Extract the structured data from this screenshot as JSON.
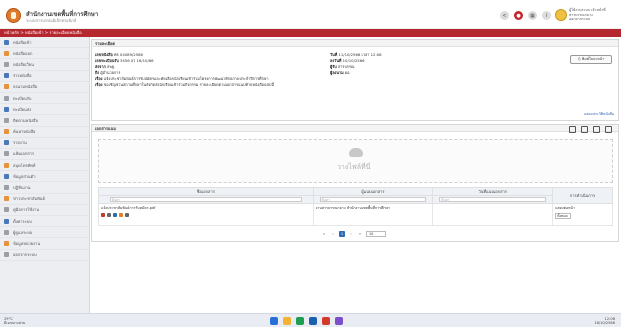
{
  "header": {
    "title": "สำนักงานเขตพื้นที่การศึกษา",
    "subtitle": "ระบบสารบรรณอิเล็กทรอนิกส์",
    "user_line1": "ผู้ใช้งานระบบ เจ้าหน้าที่",
    "user_line2": "สารบรรณกลาง",
    "user_line3": "ออกจากระบบ"
  },
  "breadcrumb": "หน้าหลัก > หนังสือเข้า > รายละเอียดหนังสือ",
  "sidebar": {
    "items": [
      {
        "label": "หนังสือเข้า",
        "icon": "inbox-icon"
      },
      {
        "label": "หนังสือออก",
        "icon": "outbox-icon"
      },
      {
        "label": "หนังสือเวียน",
        "icon": "edit-icon"
      },
      {
        "label": "ร่างหนังสือ",
        "icon": "pencil-icon"
      },
      {
        "label": "ลงนามหนังสือ",
        "icon": "document-icon"
      },
      {
        "label": "ทะเบียนรับ",
        "icon": "user-icon"
      },
      {
        "label": "ทะเบียนส่ง",
        "icon": "send-icon"
      },
      {
        "label": "ติดตามหนังสือ",
        "icon": "flag-icon"
      },
      {
        "label": "ค้นหาหนังสือ",
        "icon": "search-icon"
      },
      {
        "label": "รายงาน",
        "icon": "chart-icon"
      },
      {
        "label": "แฟ้มเอกสาร",
        "icon": "folder-icon"
      },
      {
        "label": "สมุดโทรศัพท์",
        "icon": "phone-icon"
      },
      {
        "label": "ข้อมูลส่วนตัว",
        "icon": "person-icon"
      },
      {
        "label": "ปฏิทินงาน",
        "icon": "calendar-icon"
      },
      {
        "label": "ข่าวประชาสัมพันธ์",
        "icon": "news-icon"
      },
      {
        "label": "คู่มือการใช้งาน",
        "icon": "book-icon"
      },
      {
        "label": "ตั้งค่าระบบ",
        "icon": "gear-icon"
      },
      {
        "label": "ผู้ดูแลระบบ",
        "icon": "admin-icon"
      },
      {
        "label": "ข้อมูลหน่วยงาน",
        "icon": "building-icon"
      },
      {
        "label": "ออกจากระบบ",
        "icon": "logout-icon"
      }
    ]
  },
  "detail": {
    "heading": "รายละเอียด",
    "doc_no_label": "เลขหนังสือ",
    "doc_no": "ศธ 04089/2566",
    "reg_no_label": "เลขทะเบียนรับ",
    "reg_no": "3456 ลว 16/10/66",
    "from_label": "ส่งจาก",
    "from": "สพฐ.",
    "to_label": "ถึง",
    "to": "ผู้อำนวยการ",
    "date_label": "วันที่",
    "date": "11/10/2566 เวลา 12:08",
    "doc_date_label": "ลงวันที่",
    "doc_date": "10/10/2566",
    "receiver_label": "ผู้รับ",
    "receiver": "สารบรรณ",
    "signer_label": "ผู้ลงนาม",
    "signer": "ผอ.",
    "subject_label": "เรื่อง",
    "subject": "แจ้งประชาสัมพันธ์การรับสมัครและคัดเลือกนักเรียนเข้าร่วมโครงการพัฒนาศักยภาพประจำปีการศึกษา",
    "detail_label": "เรื่อง",
    "detail_text": "ขอเชิญชวนสถานศึกษาในสังกัดส่งนักเรียนเข้าร่วมกิจกรรม รายละเอียดตามเอกสารแนบท้ายหนังสือฉบับนี้",
    "print_label": "พิมพ์ใบปะหน้า",
    "view_link": "แสดงประวัติหนังสือ"
  },
  "attachments": {
    "heading": "เอกสารแนบ",
    "dropzone_text": "วางไฟล์ที่นี่",
    "columns": [
      "ชื่อเอกสาร",
      "ผู้แนบเอกสาร",
      "วันที่แนบเอกสาร",
      "การดำเนินการ"
    ],
    "filter_placeholder": "ค้นหา",
    "rows": [
      {
        "name": "แจ้งประชาสัมพันธ์การรับสมัคร.pdf",
        "uploader": "งานสารบรรณกลาง สำนักงานเขตพื้นที่การศึกษา",
        "uploaded": "",
        "action_label": "แสดงต่อหน้า",
        "action_value": "ทั้งหมด"
      }
    ],
    "pager": {
      "prev": "«",
      "prev1": "‹",
      "current": "1",
      "next1": "›",
      "next": "»",
      "size": "10"
    }
  },
  "taskbar": {
    "weather_line1": "29°C",
    "weather_line2": "มีเมฆบางส่วน",
    "time": "12:08",
    "date": "16/10/2566"
  },
  "colors": {
    "brand": "#b5282f",
    "accent": "#2e6bb0",
    "logo": "#e07a2a"
  }
}
